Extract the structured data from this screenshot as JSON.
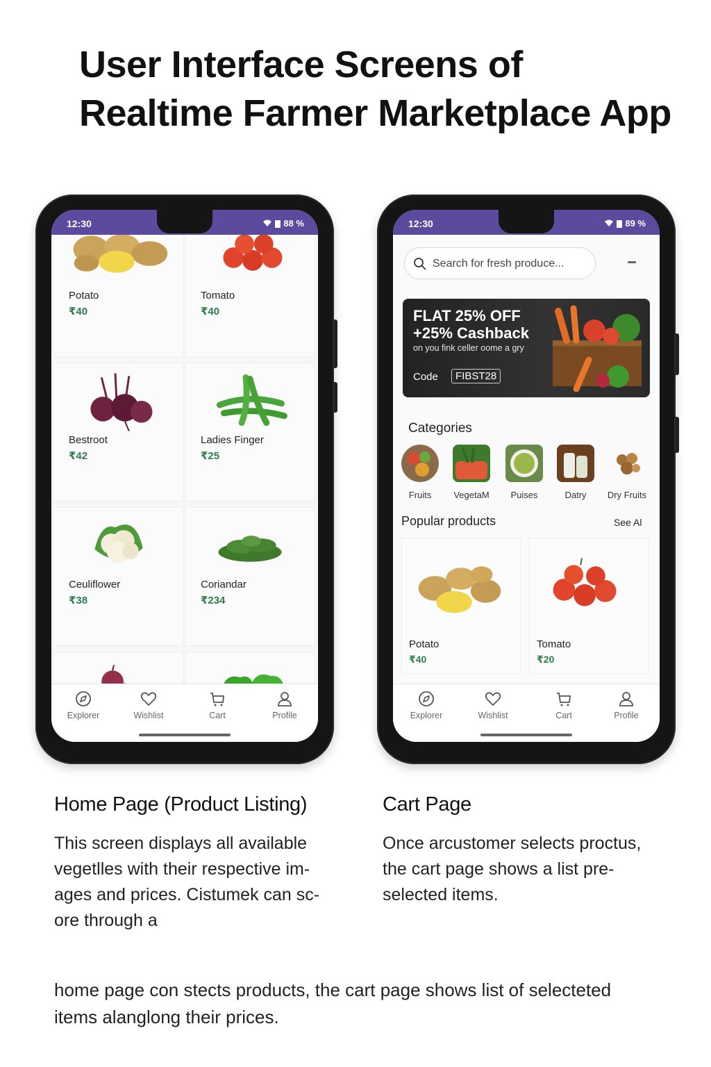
{
  "page": {
    "title_line1": "User Interface Screens of",
    "title_line2": "Realtime Farmer Marketplace App"
  },
  "home_phone": {
    "status": {
      "time": "12:30",
      "battery": "88 %"
    },
    "products": [
      {
        "name": "Potato",
        "price": "₹40"
      },
      {
        "name": "Tomato",
        "price": "₹40"
      },
      {
        "name": "Bestroot",
        "price": "₹42"
      },
      {
        "name": "Ladies Finger",
        "price": "₹25"
      },
      {
        "name": "Ceuliflower",
        "price": "₹38"
      },
      {
        "name": "Coriandar",
        "price": "₹234"
      }
    ],
    "nav": {
      "explorer": "Explorer",
      "wishlist": "Wishlist",
      "cart": "Cart",
      "profile": "Profile"
    }
  },
  "cart_phone": {
    "status": {
      "time": "12:30",
      "battery": "89 %"
    },
    "search": {
      "placeholder": "Search for fresh produce..."
    },
    "banner": {
      "line1": "FLAT 25% OFF",
      "line2": "+25% Cashback",
      "line3": "on you fink celler oome a gry",
      "code_label": "Code",
      "code_value": "FIBST28"
    },
    "categories_title": "Categories",
    "categories": [
      "Fruits",
      "VegetaM",
      "Puises",
      "Datry",
      "Dry Fruits"
    ],
    "popular_title": "Popular products",
    "see_all": "See Al",
    "popular": [
      {
        "name": "Potato",
        "price": "₹40"
      },
      {
        "name": "Tomato",
        "price": "₹20"
      }
    ],
    "nav": {
      "explorer": "Explorer",
      "wishlist": "Wishlist",
      "cart": "Cart",
      "profile": "Profile"
    }
  },
  "captions": {
    "home_title": "Home Page (Product Listing)",
    "home_body_1": "This screen displays all available",
    "home_body_2": "vegetlles with their respective im-",
    "home_body_3": "ages and prices. Cistumek can sc-",
    "home_body_4": "ore through a",
    "cart_title": "Cart Page",
    "cart_body_1": "Once arcustomer selects proctus,",
    "cart_body_2": "the cart page shows a list pre-",
    "cart_body_3": "selected items.",
    "footer_1": "home  page con stects products, the cart page shows list of selecteted",
    "footer_2": "items alanglong their prices."
  }
}
